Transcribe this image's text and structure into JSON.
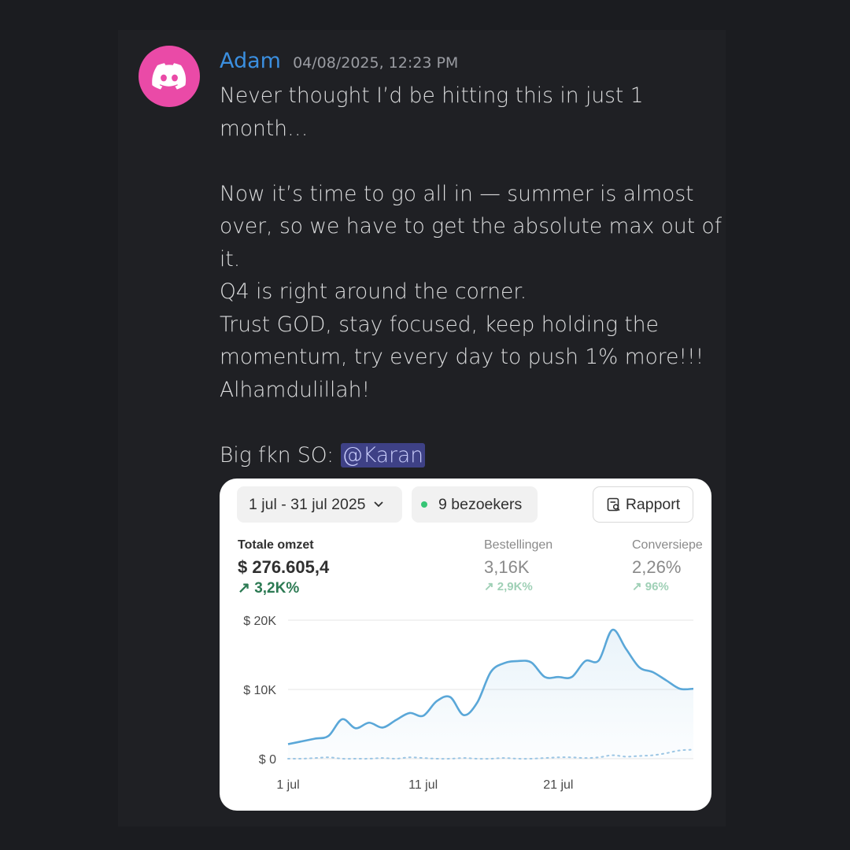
{
  "message": {
    "author": "Adam",
    "timestamp": "04/08/2025, 12:23 PM",
    "lines": [
      "Never thought I’d be hitting this in just 1 month…",
      "",
      "Now it’s time to go all in — summer is almost over, so we have to get the absolute max out of it.",
      "Q4 is right around the corner.",
      "Trust GOD, stay focused, keep holding the momentum, try every day to push 1% more!!!",
      "Alhamdulillah!",
      ""
    ],
    "shoutout_prefix": "Big fkn SO: ",
    "mention": "@Karan",
    "avatar_icon": "discord-logo-icon",
    "colors": {
      "avatar_bg": "#ea4aa7",
      "author": "#3b8fe0",
      "mention_bg": "#3e4186"
    }
  },
  "card": {
    "date_range": "1 jul - 31 jul 2025",
    "visitors": "9 bezoekers",
    "report_label": "Rapport",
    "metrics": [
      {
        "label": "Totale omzet",
        "value": "$ 276.605,4",
        "change": "↗ 3,2K%"
      },
      {
        "label": "Bestellingen",
        "value": "3,16K",
        "change": "↗ 2,9K%"
      },
      {
        "label": "Conversiepe",
        "value": "2,26%",
        "change": "↗ 96%"
      }
    ]
  },
  "chart_data": {
    "type": "line",
    "y_tick_labels": [
      "$ 20K",
      "$ 10K",
      "$ 0"
    ],
    "x_tick_labels": [
      "1 jul",
      "11 jul",
      "21 jul"
    ],
    "ylim": [
      0,
      20000
    ],
    "grid": true,
    "series": [
      {
        "x": [
          1,
          2,
          3,
          4,
          5,
          6,
          7,
          8,
          9,
          10,
          11,
          12,
          13,
          14,
          15,
          16,
          17,
          18,
          19,
          20,
          21,
          22,
          23,
          24,
          25,
          26,
          27,
          28,
          29,
          30,
          31
        ],
        "values": [
          2100,
          2500,
          2900,
          3300,
          5700,
          4400,
          5200,
          4500,
          5600,
          6600,
          6200,
          8300,
          8900,
          6300,
          8100,
          12500,
          13800,
          14100,
          13900,
          11800,
          11800,
          11800,
          14100,
          14200,
          18600,
          15900,
          13200,
          12500,
          11300,
          10100,
          10100
        ],
        "color": "#5aa7d8"
      },
      {
        "x": [
          1,
          2,
          3,
          4,
          5,
          6,
          7,
          8,
          9,
          10,
          11,
          12,
          13,
          14,
          15,
          16,
          17,
          18,
          19,
          20,
          21,
          22,
          23,
          24,
          25,
          26,
          27,
          28,
          29,
          30,
          31
        ],
        "values": [
          0,
          0,
          100,
          200,
          0,
          0,
          0,
          100,
          0,
          200,
          100,
          0,
          0,
          100,
          0,
          0,
          100,
          0,
          0,
          100,
          200,
          200,
          100,
          200,
          500,
          300,
          400,
          500,
          800,
          1200,
          1300
        ],
        "color": "#9cc6e4",
        "dashed": true
      }
    ]
  }
}
